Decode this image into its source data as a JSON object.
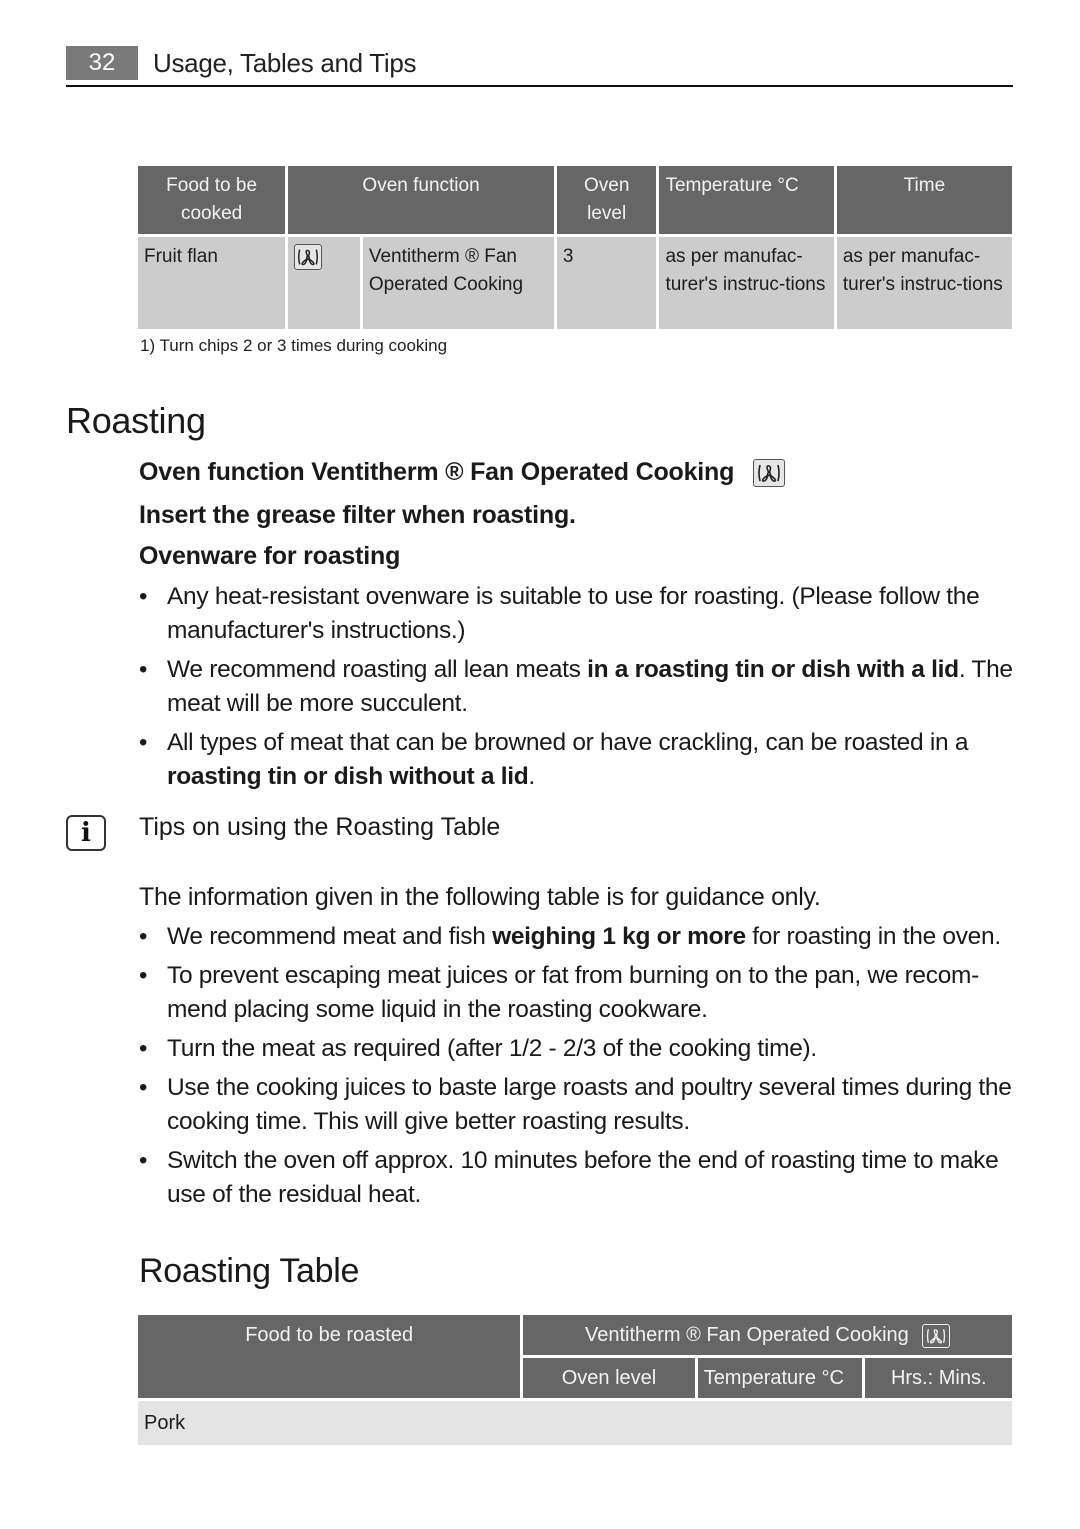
{
  "header": {
    "page_number": "32",
    "title": "Usage, Tables and Tips"
  },
  "baking_table": {
    "headers": [
      "Food to be cooked",
      "Oven function",
      "Oven level",
      "Temperature °C",
      "Time"
    ],
    "rows": [
      {
        "food": "Fruit flan",
        "function_icon": "fan-icon",
        "function": "Ventitherm ® Fan Operated Cooking",
        "level": "3",
        "temperature": "as per manufac-turer's instruc-tions",
        "time": "as per manufac-turer's instruc-tions"
      }
    ],
    "footnote": "1) Turn chips 2 or 3 times during cooking"
  },
  "roasting": {
    "heading": "Roasting",
    "oven_function": "Oven function Ventitherm ® Fan Operated Cooking",
    "grease_filter": "Insert the grease filter when roasting.",
    "ovenware_heading": "Ovenware for roasting",
    "ovenware_bullets": [
      {
        "pre": "Any heat-resistant ovenware is suitable to use for roasting. (Please follow the manufacturer's instructions.)",
        "bold": "",
        "post": ""
      },
      {
        "pre": "We recommend roasting all lean meats ",
        "bold": "in a roasting tin or dish with a lid",
        "post": ". The meat will be more succulent."
      },
      {
        "pre": "All types of meat that can be browned or have crackling, can be roasted in a ",
        "bold": "roasting tin or dish without a lid",
        "post": "."
      }
    ],
    "tips_title": "Tips on using the Roasting Table",
    "guidance": "The information given in the following table is for guidance only.",
    "tips_bullets": [
      {
        "pre": "We recommend meat and fish ",
        "bold": "weighing 1 kg or more",
        "post": " for roasting in the oven."
      },
      {
        "pre": "To prevent escaping meat juices or fat from burning on to the pan, we recom-mend placing some liquid in the roasting cookware.",
        "bold": "",
        "post": ""
      },
      {
        "pre": "Turn the meat as required (after 1/2 - 2/3 of the cooking time).",
        "bold": "",
        "post": ""
      },
      {
        "pre": "Use the cooking juices to baste large roasts and poultry several times during the cooking time. This will give better roasting results.",
        "bold": "",
        "post": ""
      },
      {
        "pre": "Switch the oven off approx. 10 minutes before the end of roasting time to make use of the residual heat.",
        "bold": "",
        "post": ""
      }
    ]
  },
  "roasting_table": {
    "heading": "Roasting Table",
    "col_food": "Food to be roasted",
    "col_group": "Ventitherm ® Fan Operated Cooking",
    "subcols": [
      "Oven level",
      "Temperature °C",
      "Hrs.: Mins."
    ],
    "sections": [
      "Pork"
    ]
  }
}
